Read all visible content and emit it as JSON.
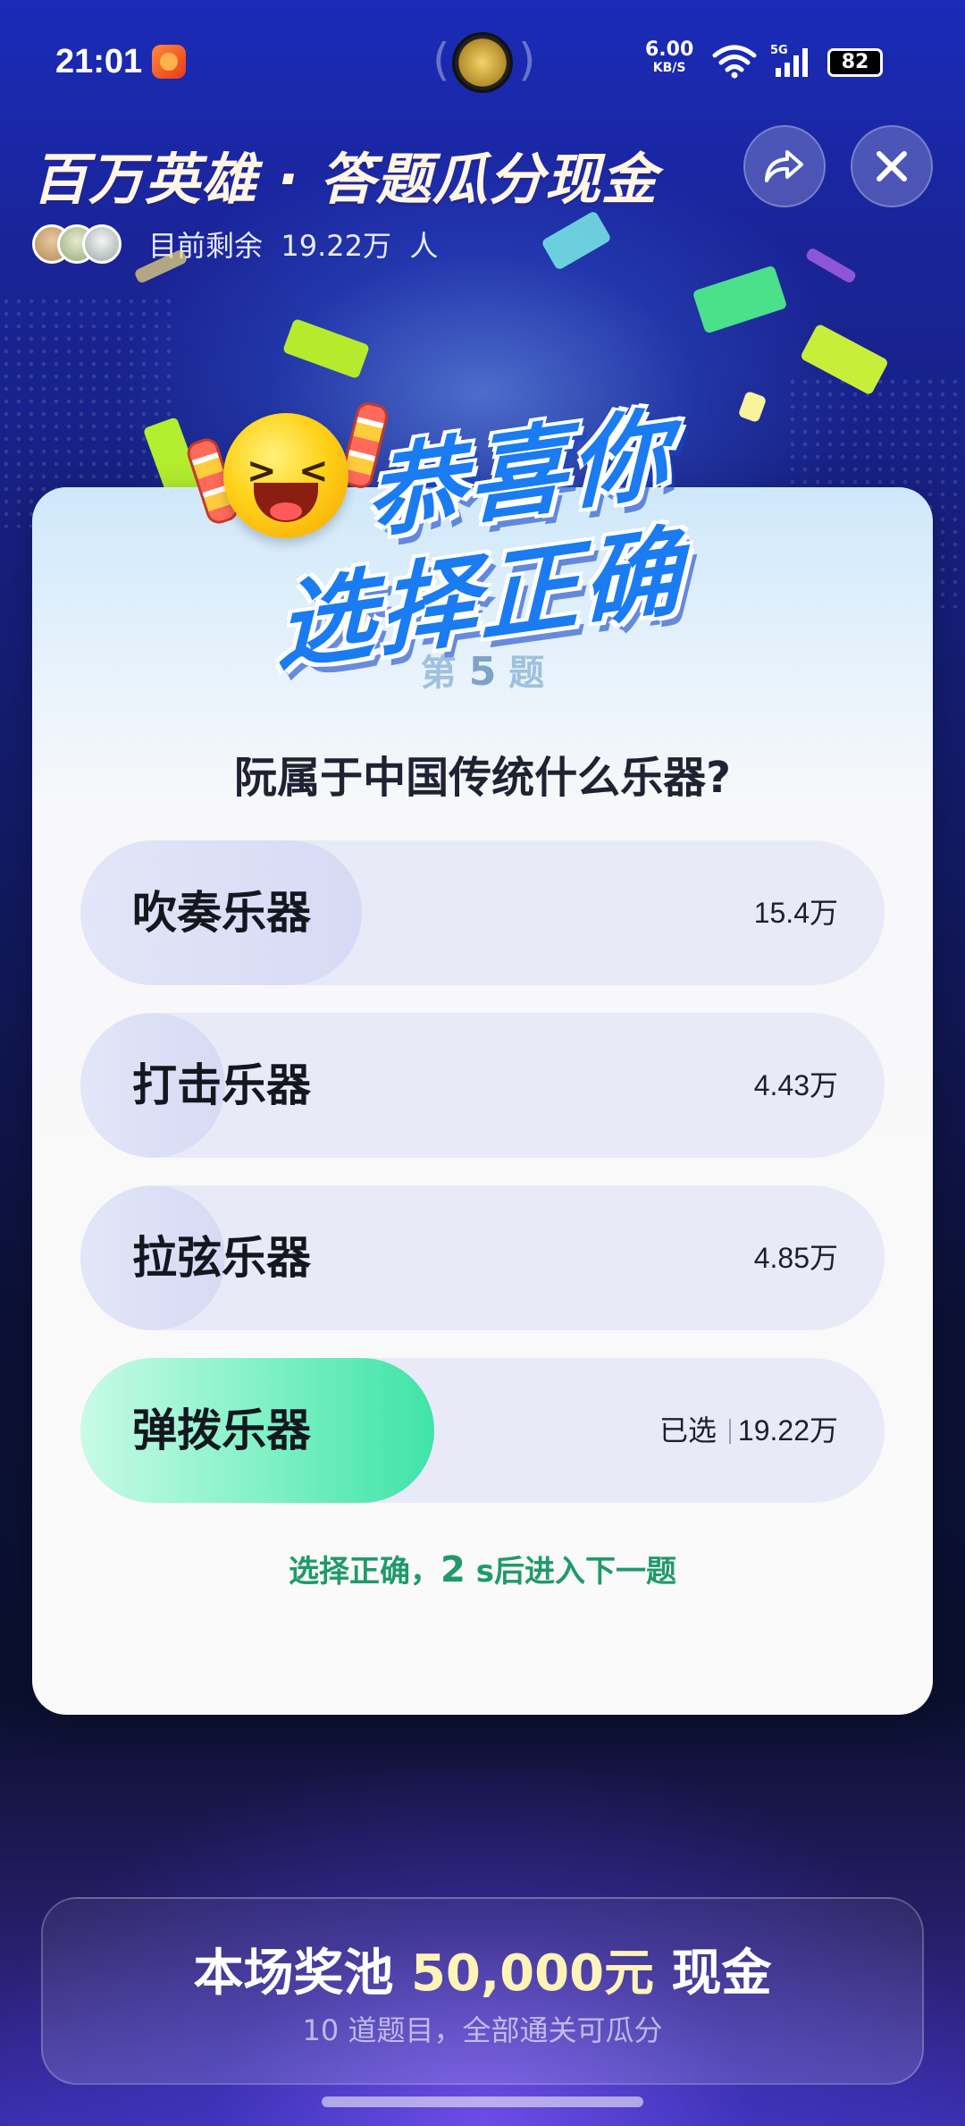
{
  "status_bar": {
    "time": "21:01",
    "net_speed": "6.00",
    "net_unit": "KB/S",
    "signal_label": "5G",
    "battery": "82"
  },
  "header": {
    "title": "百万英雄 · 答题瓜分现金",
    "remaining_label": "目前剩余",
    "remaining_count": "19.22万",
    "remaining_unit": "人"
  },
  "banner": {
    "line1": "恭喜你",
    "line2": "选择正确"
  },
  "question": {
    "prefix": "第",
    "number": "5",
    "suffix": "题",
    "text": "阮属于中国传统什么乐器?"
  },
  "options": [
    {
      "label": "吹奏乐器",
      "count": "15.4万",
      "share": 0.35,
      "correct": false,
      "selected": false
    },
    {
      "label": "打击乐器",
      "count": "4.43万",
      "share": 0.17,
      "correct": false,
      "selected": false
    },
    {
      "label": "拉弦乐器",
      "count": "4.85万",
      "share": 0.17,
      "correct": false,
      "selected": false
    },
    {
      "label": "弹拨乐器",
      "count": "19.22万",
      "share": 0.44,
      "correct": true,
      "selected": true,
      "selected_text": "已选"
    }
  ],
  "hint": {
    "before": "选择正确，",
    "seconds": "2",
    "after": " s后进入下一题"
  },
  "prize": {
    "label": "本场奖池",
    "amount": "50,000元",
    "suffix": "现金",
    "subtitle": "10 道题目，全部通关可瓜分"
  },
  "colors": {
    "correct_fill": "#3fe3a7",
    "hint_color": "#1f9a6a",
    "banner_blue": "#1a7cf0"
  }
}
